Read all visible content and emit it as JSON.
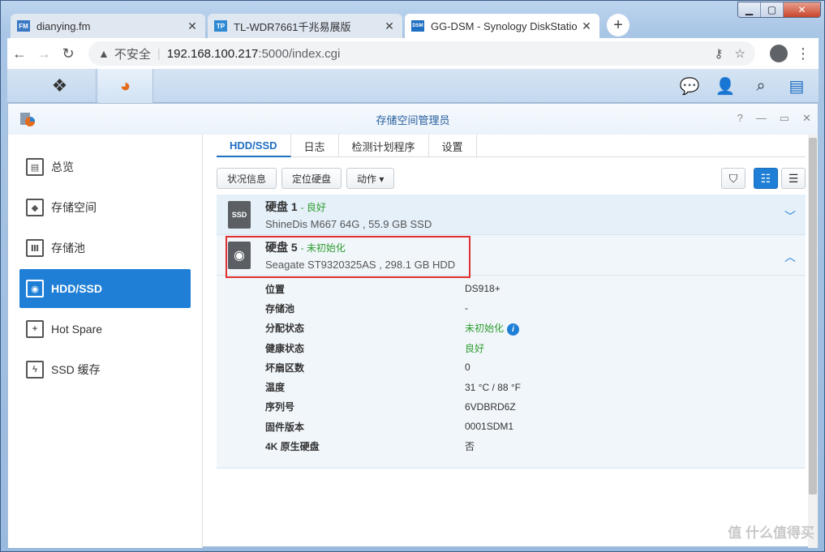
{
  "browser": {
    "tabs": [
      {
        "favicon": "FM",
        "label": "dianying.fm",
        "color": "#3a78c4"
      },
      {
        "favicon": "TP",
        "label": "TL-WDR7661千兆易展版",
        "color": "#2f8ad4"
      },
      {
        "favicon": "DSM",
        "label": "GG-DSM - Synology DiskStatio",
        "color": "#1f6fc3"
      }
    ],
    "security": "不安全",
    "url_host": "192.168.100.217",
    "url_path": ":5000/index.cgi"
  },
  "app": {
    "title": "存储空间管理员",
    "sidebar": [
      {
        "label": "总览",
        "glyph": "▤"
      },
      {
        "label": "存储空间",
        "glyph": "◆"
      },
      {
        "label": "存储池",
        "glyph": "Ⅲ"
      },
      {
        "label": "HDD/SSD",
        "glyph": "◉"
      },
      {
        "label": "Hot Spare",
        "glyph": "+"
      },
      {
        "label": "SSD 缓存",
        "glyph": "ϟ"
      }
    ],
    "tabs": [
      "HDD/SSD",
      "日志",
      "检测计划程序",
      "设置"
    ],
    "toolbar": {
      "status_btn": "状况信息",
      "locate_btn": "定位硬盘",
      "action_btn": "动作 ▾"
    },
    "disk1": {
      "icon": "SSD",
      "title": "硬盘 1",
      "status": "良好",
      "desc": "ShineDis M667 64G , 55.9 GB SSD"
    },
    "disk5": {
      "title": "硬盘 5",
      "status": "未初始化",
      "desc": "Seagate ST9320325AS , 298.1 GB HDD"
    },
    "details": [
      {
        "k": "位置",
        "v": "DS918+"
      },
      {
        "k": "存储池",
        "v": "-"
      },
      {
        "k": "分配状态",
        "v": "未初始化",
        "green": true,
        "info": true
      },
      {
        "k": "健康状态",
        "v": "良好",
        "green": true
      },
      {
        "k": "坏扇区数",
        "v": "0"
      },
      {
        "k": "温度",
        "v": "31 °C / 88 °F"
      },
      {
        "k": "序列号",
        "v": "6VDBRD6Z"
      },
      {
        "k": "固件版本",
        "v": "0001SDM1"
      },
      {
        "k": "4K 原生硬盘",
        "v": "否"
      }
    ]
  },
  "watermark": "值 什么值得买"
}
